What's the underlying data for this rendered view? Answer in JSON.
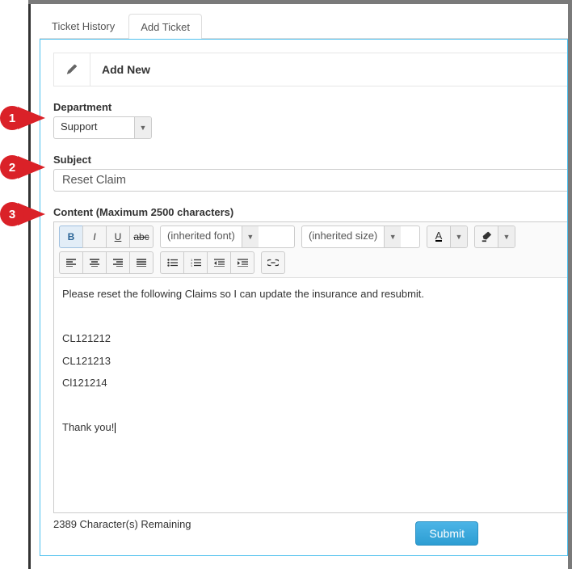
{
  "tabs": {
    "history": "Ticket History",
    "add": "Add Ticket"
  },
  "header": {
    "title": "Add New"
  },
  "department": {
    "label": "Department",
    "value": "Support"
  },
  "subject": {
    "label": "Subject",
    "value": "Reset Claim"
  },
  "content": {
    "label": "Content (Maximum 2500 characters)",
    "font_value": "(inherited font)",
    "size_value": "(inherited size)",
    "body_lines": [
      "Please reset the following Claims so I can update the insurance and resubmit.",
      "",
      "CL121212",
      "CL121213",
      "Cl121214",
      "",
      "Thank you!"
    ],
    "char_count": "2389 Character(s) Remaining"
  },
  "submit_label": "Submit",
  "callouts": {
    "c1": "1",
    "c2": "2",
    "c3": "3"
  }
}
